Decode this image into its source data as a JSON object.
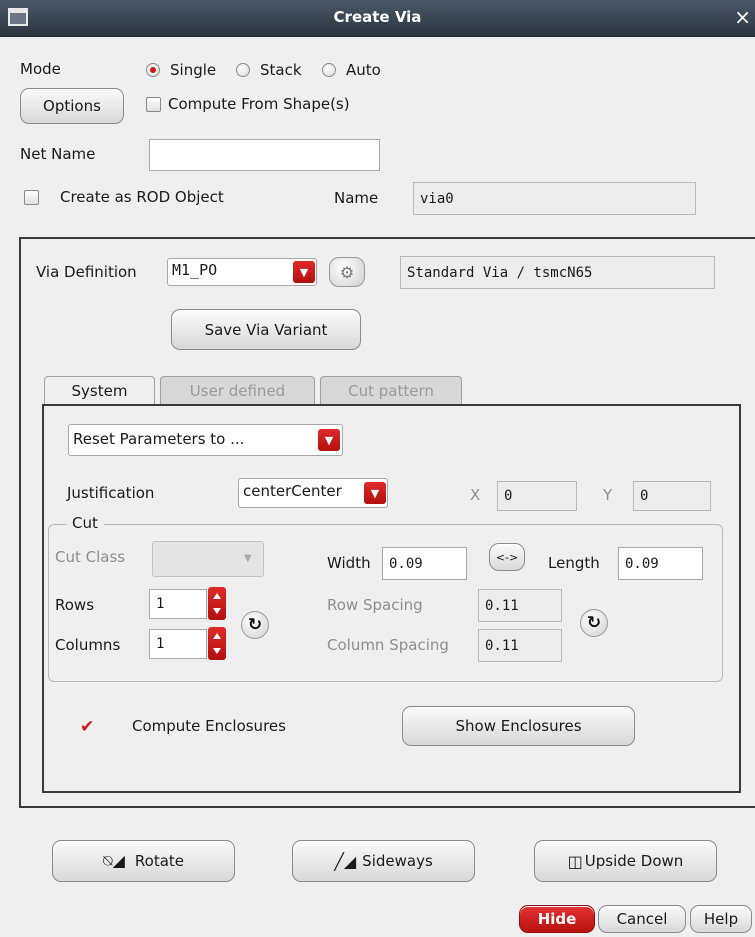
{
  "window": {
    "title": "Create Via",
    "close": "×"
  },
  "mode": {
    "label": "Mode",
    "options": [
      "Single",
      "Stack",
      "Auto"
    ],
    "selected": "Single"
  },
  "options_button": "Options",
  "compute_from_shapes": {
    "label": "Compute From Shape(s)",
    "checked": false
  },
  "net_name": {
    "label": "Net Name",
    "value": ""
  },
  "rod": {
    "label": "Create as ROD Object",
    "checked": false
  },
  "name": {
    "label": "Name",
    "value": "via0"
  },
  "via_definition": {
    "label": "Via Definition",
    "value": "M1_PO",
    "description": "Standard Via / tsmcN65"
  },
  "save_via_variant": "Save Via Variant",
  "tabs": [
    {
      "label": "System",
      "active": true
    },
    {
      "label": "User defined",
      "active": false
    },
    {
      "label": "Cut pattern",
      "active": false
    }
  ],
  "reset_parameters": "Reset Parameters to ...",
  "justification": {
    "label": "Justification",
    "value": "centerCenter"
  },
  "x": {
    "label": "X",
    "value": "0"
  },
  "y": {
    "label": "Y",
    "value": "0"
  },
  "cut": {
    "legend": "Cut",
    "cut_class_label": "Cut Class",
    "width_label": "Width",
    "width_value": "0.09",
    "swap_label": "<->",
    "length_label": "Length",
    "length_value": "0.09",
    "rows_label": "Rows",
    "rows_value": "1",
    "columns_label": "Columns",
    "columns_value": "1",
    "row_spacing_label": "Row Spacing",
    "row_spacing_value": "0.11",
    "column_spacing_label": "Column Spacing",
    "column_spacing_value": "0.11",
    "swap_symbol": "↻"
  },
  "compute_enclosures": {
    "label": "Compute Enclosures",
    "checked": true
  },
  "show_enclosures": "Show Enclosures",
  "transforms": {
    "rotate": "Rotate",
    "sideways": "Sideways",
    "upside_down": "Upside Down"
  },
  "footer": {
    "hide": "Hide",
    "cancel": "Cancel",
    "help": "Help"
  },
  "colors": {
    "accent": "#d01818",
    "titlebar": "#2b3640"
  }
}
